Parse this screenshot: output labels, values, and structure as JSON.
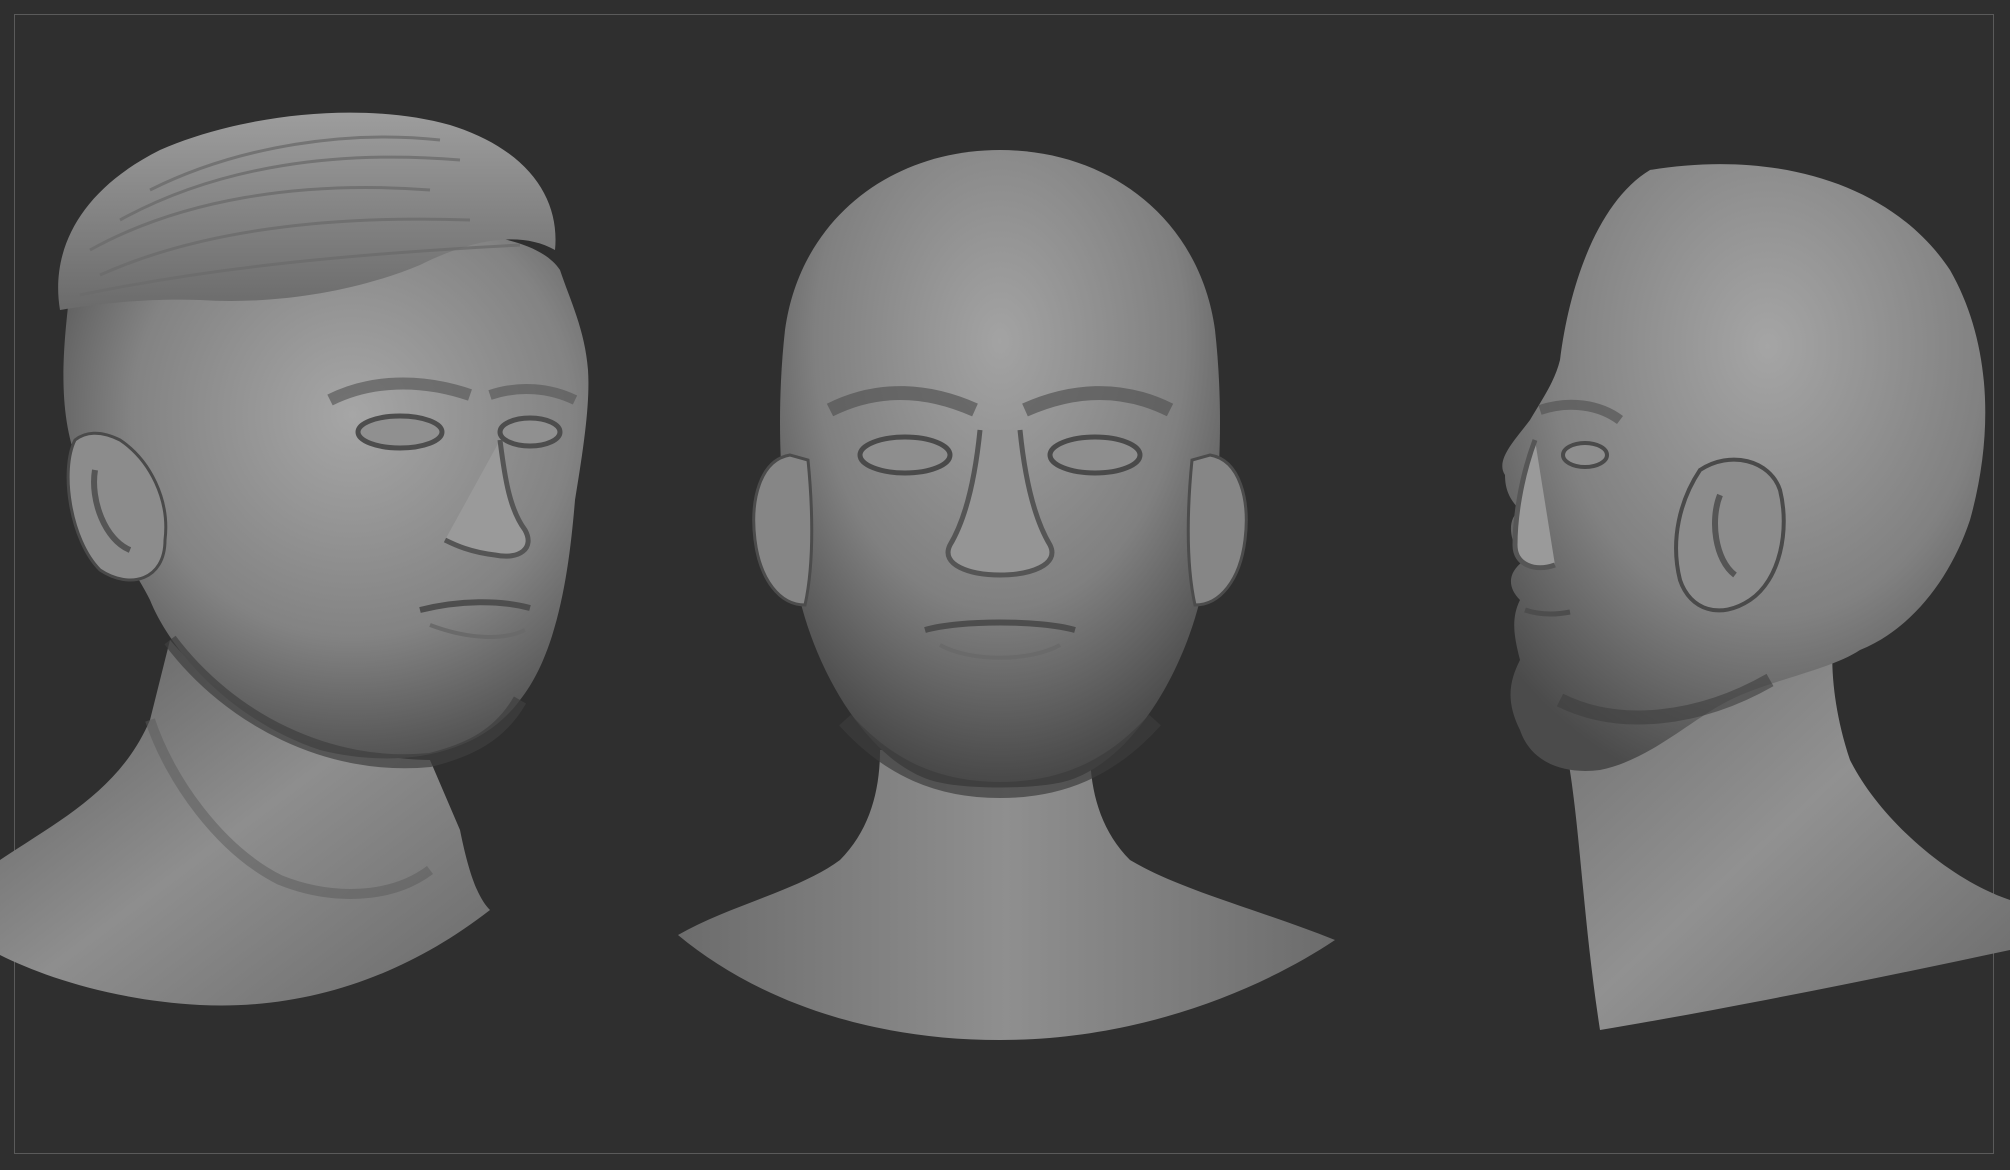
{
  "viewport": {
    "background_color": "#2f2f2f",
    "frame_color": "#5a5a5a",
    "clay_highlight": "#a9a9a9",
    "clay_mid": "#7d7d7d",
    "clay_shadow": "#3c3c3c"
  },
  "models": [
    {
      "view": "three-quarter",
      "has_hair": true
    },
    {
      "view": "front",
      "has_hair": false
    },
    {
      "view": "profile",
      "has_hair": false
    }
  ]
}
